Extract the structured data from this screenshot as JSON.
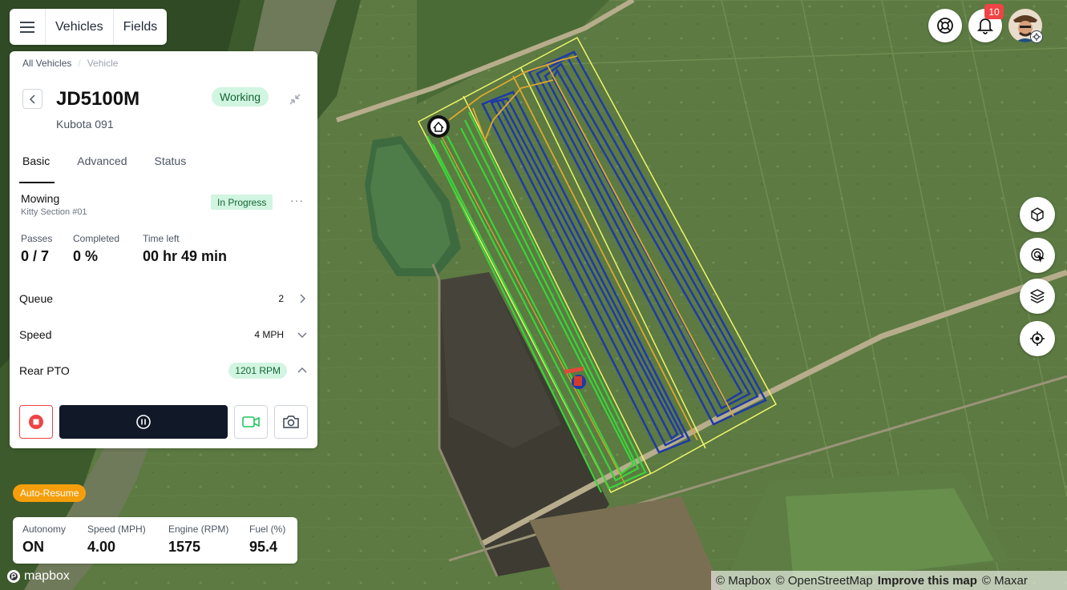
{
  "nav": {
    "vehicles_label": "Vehicles",
    "fields_label": "Fields"
  },
  "breadcrumb": [
    "All Vehicles",
    "Vehicle"
  ],
  "vehicle": {
    "name": "JD5100M",
    "subtitle": "Kubota 091",
    "status": "Working"
  },
  "tabs": [
    "Basic",
    "Advanced",
    "Status"
  ],
  "task": {
    "title": "Mowing",
    "subtitle": "Kitty Section #01",
    "status": "In Progress"
  },
  "stats": {
    "passes_label": "Passes",
    "passes_value": "0 / 7",
    "completed_label": "Completed",
    "completed_value": "0 %",
    "timeleft_label": "Time left",
    "timeleft_value": "00 hr 49 min"
  },
  "rows": {
    "queue_label": "Queue",
    "queue_value": "2",
    "speed_label": "Speed",
    "speed_value": "4 MPH",
    "pto_label": "Rear PTO",
    "pto_value": "1201 RPM"
  },
  "notifications": {
    "count": "10"
  },
  "auto_resume_label": "Auto-Resume",
  "telemetry": {
    "autonomy_label": "Autonomy",
    "autonomy_value": "ON",
    "speed_label": "Speed (MPH)",
    "speed_value": "4.00",
    "engine_label": "Engine (RPM)",
    "engine_value": "1575",
    "fuel_label": "Fuel (%)",
    "fuel_value": "95.4"
  },
  "map": {
    "logo_text": "mapbox",
    "attribution_1": "© Mapbox",
    "attribution_2": "© OpenStreetMap",
    "attribution_3": "Improve this map",
    "attribution_4": "© Maxar"
  },
  "colors": {
    "accent_green": "#d1f5e1",
    "stop_red": "#ef4444",
    "auto_resume": "#f59e0b",
    "pass_done": "#3ad43a",
    "pass_planned": "#1f3aa8",
    "path_transit": "#e0a82e"
  }
}
